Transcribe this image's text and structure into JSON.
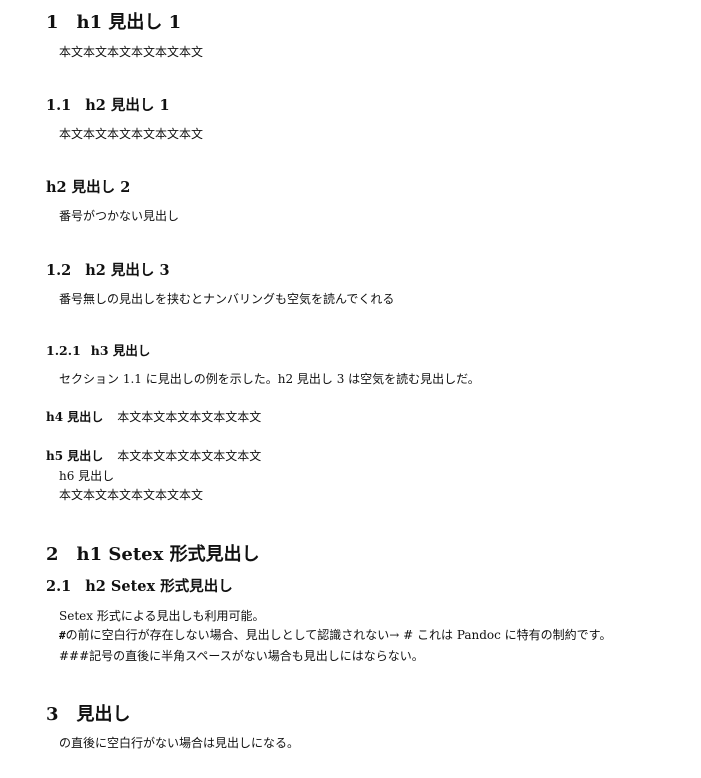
{
  "s1": {
    "num": "1",
    "title": "h1 見出し 1",
    "body": "本文本文本文本文本文本文"
  },
  "s1_1": {
    "num": "1.1",
    "title": "h2 見出し 1",
    "body": "本文本文本文本文本文本文"
  },
  "h2_unnumbered": {
    "title": "h2 見出し 2",
    "body": "番号がつかない見出し"
  },
  "s1_2": {
    "num": "1.2",
    "title": "h2 見出し 3",
    "body": "番号無しの見出しを挟むとナンバリングも空気を読んでくれる"
  },
  "s1_2_1": {
    "num": "1.2.1",
    "title": "h3 見出し",
    "body": "セクション 1.1 に見出しの例を示した。h2 見出し 3 は空気を読む見出しだ。"
  },
  "h4": {
    "title": "h4 見出し",
    "body": "本文本文本文本文本文本文"
  },
  "h5": {
    "title": "h5 見出し",
    "body": "本文本文本文本文本文本文"
  },
  "h6": {
    "title": "h6 見出し",
    "body": "本文本文本文本文本文本文"
  },
  "s2": {
    "num": "2",
    "title": "h1 Setex 形式見出し"
  },
  "s2_1": {
    "num": "2.1",
    "title": "h2 Setex 形式見出し",
    "line1": "Setex 形式による見出しも利用可能。",
    "line2_prefix": "#",
    "line2_text": "の前に空白行が存在しない場合、見出しとして認識されない→ # これは Pandoc に特有の制約です。",
    "line3": "###記号の直後に半角スペースがない場合も見出しにはならない。"
  },
  "s3": {
    "num": "3",
    "title": "見出し",
    "body": "の直後に空白行がない場合は見出しになる。"
  }
}
